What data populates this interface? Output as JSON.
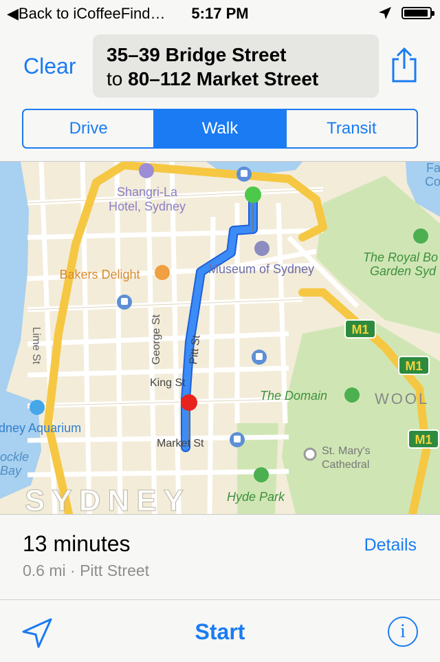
{
  "status_bar": {
    "back_label": "Back to iCoffeeFind…",
    "time": "5:17 PM",
    "location_icon": "location-arrow-icon",
    "battery_icon": "battery-icon",
    "battery_level": 0.95
  },
  "header": {
    "clear_label": "Clear",
    "from": "35–39 Bridge Street",
    "to_prefix": "to",
    "to": "80–112 Market Street",
    "share_icon": "share-icon"
  },
  "transport_modes": [
    {
      "label": "Drive",
      "selected": false
    },
    {
      "label": "Walk",
      "selected": true
    },
    {
      "label": "Transit",
      "selected": false
    }
  ],
  "map": {
    "labels": {
      "shangri_la_1": "Shangri-La",
      "shangri_la_2": "Hotel, Sydney",
      "bakers": "Bakers Delight",
      "museum": "Museum of Sydney",
      "royal_1": "The Royal Bo",
      "royal_2": "Garden Syd",
      "lime": "Lime St",
      "george": "George St",
      "pitt": "Pitt St",
      "king": "King St",
      "domain": "The Domain",
      "wooll": "WOOL",
      "aquarium": "dney Aquarium",
      "cockle_1": "ockle",
      "cockle_2": "Bay",
      "market": "Market St",
      "stmarys_1": "St. Mary's",
      "stmarys_2": "Cathedral",
      "hyde": "Hyde Park",
      "sydney": "SYDNEY",
      "farm_1": "Fa",
      "farm_2": "Co",
      "m1_1": "M1",
      "m1_2": "M1",
      "m1_3": "M1"
    },
    "colors": {
      "route": "#2d7ff5",
      "start_pin": "#4cc84a",
      "end_pin": "#e8221c",
      "park": "#cfe6b4",
      "water": "#a8d0f0",
      "major_road": "#f6c742"
    }
  },
  "summary": {
    "duration": "13 minutes",
    "details_label": "Details",
    "subtitle": "0.6 mi · Pitt Street"
  },
  "toolbar": {
    "start_label": "Start",
    "info_label": "i",
    "location_icon": "location-arrow-icon"
  }
}
